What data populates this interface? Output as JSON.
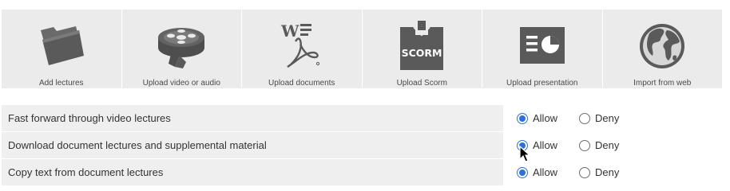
{
  "colors": {
    "tile_bg": "#ebebeb",
    "icon_gray": "#5a5a5a",
    "row_bg": "#efefef",
    "radio_accent": "#2f6fdb"
  },
  "tiles": [
    {
      "label": "Add lectures",
      "icon": "folder-icon"
    },
    {
      "label": "Upload video or audio",
      "icon": "film-reel-icon"
    },
    {
      "label": "Upload documents",
      "icon": "document-pdf-icon"
    },
    {
      "label": "Upload Scorm",
      "icon": "scorm-package-icon",
      "icon_text": "SCORM"
    },
    {
      "label": "Upload presentation",
      "icon": "presentation-icon"
    },
    {
      "label": "Import from web",
      "icon": "globe-icon"
    }
  ],
  "permissions": {
    "rows": [
      {
        "label": "Fast forward through video lectures",
        "allow_label": "Allow",
        "deny_label": "Deny",
        "selected": "allow"
      },
      {
        "label": "Download document lectures and supplemental material",
        "allow_label": "Allow",
        "deny_label": "Deny",
        "selected": "allow"
      },
      {
        "label": "Copy text from document lectures",
        "allow_label": "Allow",
        "deny_label": "Deny",
        "selected": "allow"
      }
    ]
  }
}
